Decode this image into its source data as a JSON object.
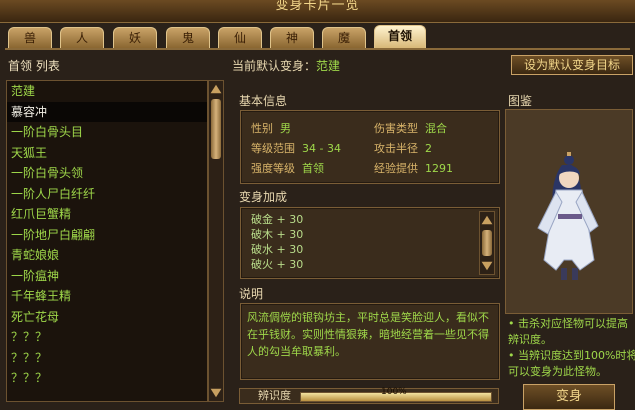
{
  "window": {
    "title": "变身卡片一览"
  },
  "tabs": [
    {
      "label": "兽",
      "active": false
    },
    {
      "label": "人",
      "active": false
    },
    {
      "label": "妖",
      "active": false
    },
    {
      "label": "鬼",
      "active": false
    },
    {
      "label": "仙",
      "active": false
    },
    {
      "label": "神",
      "active": false
    },
    {
      "label": "魔",
      "active": false
    },
    {
      "label": "首领",
      "active": true
    }
  ],
  "list": {
    "header": "首领 列表",
    "items": [
      "范建",
      "慕容冲",
      "一阶白骨头目",
      "天狐王",
      "一阶白骨头领",
      "一阶人尸白纤纤",
      "红爪巨蟹精",
      "一阶地尸白翩翩",
      "青蛇娘娘",
      "一阶瘟神",
      "千年蜂王精",
      "死亡花母",
      "？？？",
      "？？？",
      "？？？"
    ],
    "selected_index": 1
  },
  "current": {
    "label": "当前默认变身：",
    "value": "范建"
  },
  "set_default_button": "设为默认变身目标",
  "basic": {
    "title": "基本信息",
    "rows": [
      {
        "l1": "性别",
        "v1": "男",
        "l2": "伤害类型",
        "v2": "混合"
      },
      {
        "l1": "等级范围",
        "v1": "34 - 34",
        "l2": "攻击半径",
        "v2": "2"
      },
      {
        "l1": "强度等级",
        "v1": "首领",
        "l2": "经验提供",
        "v2": "1291"
      }
    ]
  },
  "morph": {
    "title": "变身加成",
    "lines": [
      "破金 + 30",
      "破木 + 30",
      "破水 + 30",
      "破火 + 30"
    ]
  },
  "desc": {
    "title": "说明",
    "text": "风流倜傥的银钩坊主，平时总是笑脸迎人，看似不在乎钱财。实则性情狠辣，暗地经营着一些见不得人的勾当牟取暴利。"
  },
  "tujian": {
    "title": "图鉴",
    "hints": [
      "• 击杀对应怪物可以提高辨识度。",
      "• 当辨识度达到100%时将可以变身为此怪物。"
    ]
  },
  "bottom": {
    "label": "辨识度",
    "progress": 1.0,
    "progress_text": "100%"
  },
  "change_button": "变身",
  "colors": {
    "accent_green": "#9fd84a",
    "gold": "#d9b56a",
    "bg": "#2a2119"
  }
}
